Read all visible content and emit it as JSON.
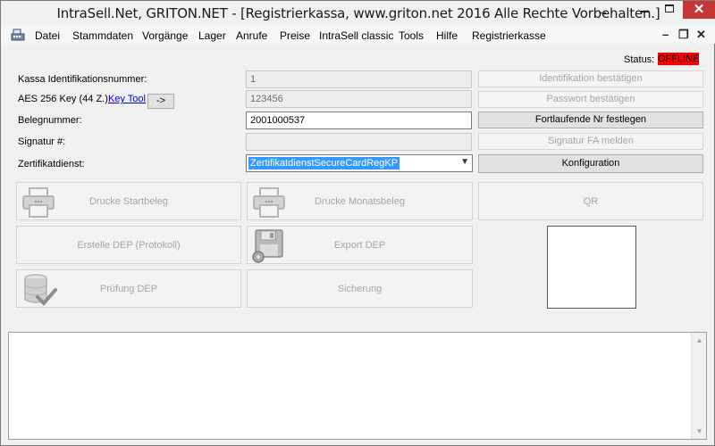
{
  "window": {
    "title": "IntraSell.Net, GRITON.NET - [Registrierkassa, www.griton.net 2016 Alle Rechte Vorbehalten.]",
    "title_suffix": "↔"
  },
  "menu": {
    "items": [
      "Datei",
      "Stammdaten",
      "Vorgänge",
      "Lager",
      "Anrufe",
      "Preise",
      "IntraSell classic",
      "Tools",
      "Hilfe",
      "Registrierkasse"
    ]
  },
  "status": {
    "label": "Status:",
    "value": "OFFLINE",
    "color": "#ff0000"
  },
  "form": {
    "kasse_id_label": "Kassa Identifikationsnummer:",
    "kasse_id_value": "1",
    "aes_label": "AES 256 Key (44 Z.):",
    "key_tool_link": "Key Tool",
    "arrow_button": "->",
    "aes_value": "123456",
    "belegnummer_label": "Belegnummer:",
    "belegnummer_value": "2001000537",
    "signatur_label": "Signatur #:",
    "signatur_value": "",
    "zertifikat_label": "Zertifikatdienst:",
    "zertifikat_value": "ZertifikatdienstSecureCardRegKP"
  },
  "side_buttons": {
    "identifikation": "Identifikation bestätigen",
    "passwort": "Passwort bestätigen",
    "fortlaufende": "Fortlaufende Nr festlegen",
    "signatur_fa": "Signatur FA melden",
    "konfiguration": "Konfiguration"
  },
  "actions": {
    "drucke_startbeleg": "Drucke Startbeleg",
    "drucke_monatsbeleg": "Drucke Monatsbeleg",
    "qr": "QR",
    "erstelle_dep": "Erstelle DEP (Protokoll)",
    "export_dep": "Export DEP",
    "pruefung_dep": "Prüfung DEP",
    "sicherung": "Sicherung"
  },
  "icons": {
    "app": "register-app-icon",
    "printer": "printer-icon",
    "floppy": "floppy-disk-icon",
    "database": "database-check-icon"
  }
}
